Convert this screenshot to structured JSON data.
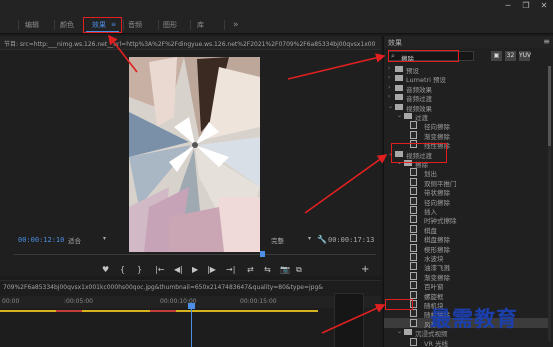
{
  "workspace": {
    "tabs": [
      {
        "label": "编辑"
      },
      {
        "label": "颜色"
      },
      {
        "label": "效果"
      },
      {
        "label": "音频"
      },
      {
        "label": "图形"
      },
      {
        "label": "库"
      }
    ],
    "active_menu_icon": "≡",
    "more": "»",
    "window_controls": [
      "─",
      "❐",
      "✕"
    ]
  },
  "monitor": {
    "title": "节目: src=http:___nimg.ws.126.net__url=http%3A%2F%2Fdingyue.ws.126.net%2F2021%2F0709%2F6a85334bj00qvsx1x001kc000hs00qoc.jpg&thumbna",
    "timecode_current": "00:00:12:10",
    "fit": "适合",
    "quality": "完整",
    "timecode_duration": "00:00:17:13",
    "transport": [
      "♥",
      "{",
      "}",
      "|←",
      "◀|",
      "▶",
      "|▶",
      "→|",
      "⇄",
      "⇆",
      "📷",
      "⧉"
    ],
    "add": "+"
  },
  "timeline": {
    "title": "709%2F6a85334bj00qvsx1x001kc000hs00qoc.jpg&thumbnail=650x2147483647&quality=80&type=jpg&refer=http___nimg.ws.12",
    "ruler_labels": [
      "00:00",
      ":00:05:00",
      "00:00:10:00",
      "00:00:15:00"
    ]
  },
  "effects": {
    "title": "效果",
    "menu": "≡",
    "search_value": "擦除",
    "tools": [
      "▣",
      "32",
      "YUV"
    ],
    "tree": [
      {
        "label": "预设",
        "level": 0,
        "type": "folder",
        "arrow": "›"
      },
      {
        "label": "Lumetri 预设",
        "level": 0,
        "type": "folder",
        "arrow": "›"
      },
      {
        "label": "音频效果",
        "level": 0,
        "type": "folder",
        "arrow": "›"
      },
      {
        "label": "音频过渡",
        "level": 0,
        "type": "folder",
        "arrow": "›"
      },
      {
        "label": "视频效果",
        "level": 0,
        "type": "folder",
        "arrow": "⌄"
      },
      {
        "label": "过渡",
        "level": 1,
        "type": "folder",
        "arrow": "⌄"
      },
      {
        "label": "径向擦除",
        "level": 2,
        "type": "effect"
      },
      {
        "label": "渐变擦除",
        "level": 2,
        "type": "effect"
      },
      {
        "label": "线性擦除",
        "level": 2,
        "type": "effect"
      },
      {
        "label": "视频过渡",
        "level": 0,
        "type": "folder",
        "arrow": "⌄"
      },
      {
        "label": "擦除",
        "level": 1,
        "type": "folder",
        "arrow": "⌄"
      },
      {
        "label": "划出",
        "level": 2,
        "type": "effect"
      },
      {
        "label": "双侧平推门",
        "level": 2,
        "type": "effect"
      },
      {
        "label": "带状擦除",
        "level": 2,
        "type": "effect"
      },
      {
        "label": "径向擦除",
        "level": 2,
        "type": "effect"
      },
      {
        "label": "插入",
        "level": 2,
        "type": "effect"
      },
      {
        "label": "时钟式擦除",
        "level": 2,
        "type": "effect"
      },
      {
        "label": "棋盘",
        "level": 2,
        "type": "effect"
      },
      {
        "label": "棋盘擦除",
        "level": 2,
        "type": "effect"
      },
      {
        "label": "楔形擦除",
        "level": 2,
        "type": "effect"
      },
      {
        "label": "水波块",
        "level": 2,
        "type": "effect"
      },
      {
        "label": "油漆飞溅",
        "level": 2,
        "type": "effect"
      },
      {
        "label": "渐变擦除",
        "level": 2,
        "type": "effect"
      },
      {
        "label": "百叶窗",
        "level": 2,
        "type": "effect"
      },
      {
        "label": "螺旋框",
        "level": 2,
        "type": "effect"
      },
      {
        "label": "随机块",
        "level": 2,
        "type": "effect"
      },
      {
        "label": "随机擦除",
        "level": 2,
        "type": "effect"
      },
      {
        "label": "风车",
        "level": 2,
        "type": "effect",
        "selected": true
      },
      {
        "label": "沉浸式视频",
        "level": 1,
        "type": "folder",
        "arrow": "⌄"
      },
      {
        "label": "VR 光线",
        "level": 2,
        "type": "effect"
      },
      {
        "label": "VR 随机块",
        "level": 2,
        "type": "effect"
      }
    ]
  },
  "watermark": "最需教育",
  "colors": {
    "accent": "#4d8fe6",
    "annotation": "#e02020",
    "watermark": "#1c3fae"
  }
}
